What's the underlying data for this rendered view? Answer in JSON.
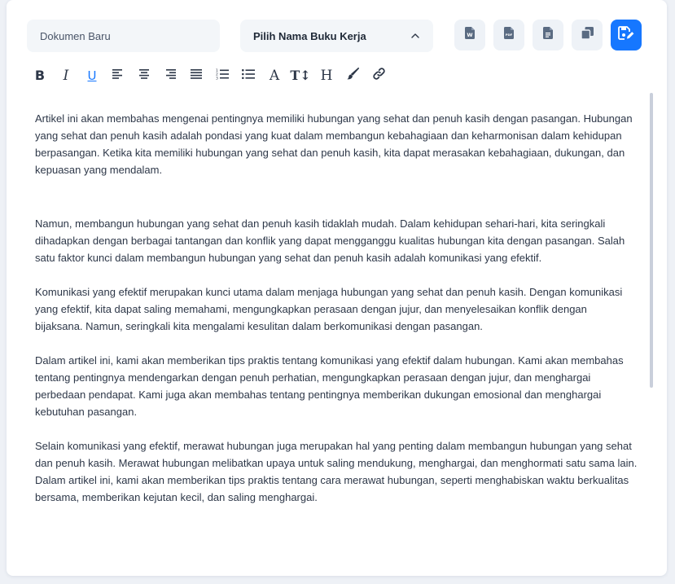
{
  "header": {
    "doc_name_placeholder": "Dokumen Baru",
    "workbook_select_label": "Pilih Nama Buku Kerja"
  },
  "actions": [
    {
      "name": "word-export-icon",
      "label": "W"
    },
    {
      "name": "pdf-export-icon",
      "label": "PDF"
    },
    {
      "name": "document-icon",
      "label": ""
    },
    {
      "name": "copy-icon",
      "label": ""
    },
    {
      "name": "save-edit-icon",
      "label": ""
    }
  ],
  "toolbar": {
    "bold": "B",
    "italic": "I",
    "underline": "U",
    "font": "A",
    "text_size": "T↕",
    "heading": "H"
  },
  "colors": {
    "accent": "#1677ff",
    "text": "#2d3748",
    "button_bg": "#eef2f7",
    "field_bg": "#f3f6f9"
  },
  "editor": {
    "paragraphs": [
      "Artikel ini akan membahas mengenai pentingnya memiliki hubungan yang sehat dan penuh kasih dengan pasangan. Hubungan yang sehat dan penuh kasih adalah pondasi yang kuat dalam membangun kebahagiaan dan keharmonisan dalam kehidupan berpasangan. Ketika kita memiliki hubungan yang sehat dan penuh kasih, kita dapat merasakan kebahagiaan, dukungan, dan kepuasan yang mendalam.",
      "Namun, membangun hubungan yang sehat dan penuh kasih tidaklah mudah. Dalam kehidupan sehari-hari, kita seringkali dihadapkan dengan berbagai tantangan dan konflik yang dapat mengganggu kualitas hubungan kita dengan pasangan. Salah satu faktor kunci dalam membangun hubungan yang sehat dan penuh kasih adalah komunikasi yang efektif.",
      "Komunikasi yang efektif merupakan kunci utama dalam menjaga hubungan yang sehat dan penuh kasih. Dengan komunikasi yang efektif, kita dapat saling memahami, mengungkapkan perasaan dengan jujur, dan menyelesaikan konflik dengan bijaksana. Namun, seringkali kita mengalami kesulitan dalam berkomunikasi dengan pasangan.",
      "Dalam artikel ini, kami akan memberikan tips praktis tentang komunikasi yang efektif dalam hubungan. Kami akan membahas tentang pentingnya mendengarkan dengan penuh perhatian, mengungkapkan perasaan dengan jujur, dan menghargai perbedaan pendapat. Kami juga akan membahas tentang pentingnya memberikan dukungan emosional dan menghargai kebutuhan pasangan.",
      "Selain komunikasi yang efektif, merawat hubungan juga merupakan hal yang penting dalam membangun hubungan yang sehat dan penuh kasih. Merawat hubungan melibatkan upaya untuk saling mendukung, menghargai, dan menghormati satu sama lain. Dalam artikel ini, kami akan memberikan tips praktis tentang cara merawat hubungan, seperti menghabiskan waktu berkualitas bersama, memberikan kejutan kecil, dan saling menghargai."
    ]
  }
}
